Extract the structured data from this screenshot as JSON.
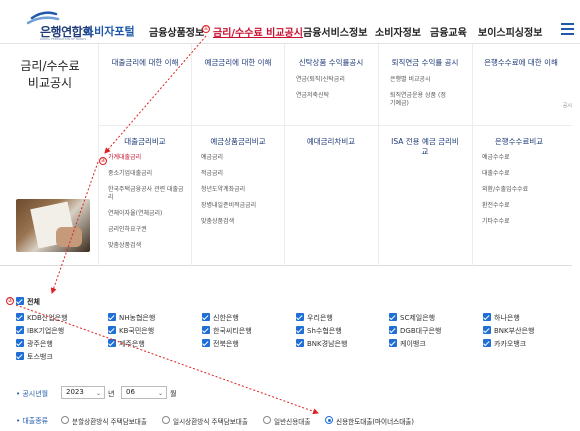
{
  "header": {
    "org_name": "은행연합회",
    "org_sub": "KOREA FEDERATION OF BANKS",
    "portal_name": "소비자포털",
    "nav": [
      "금융상품정보",
      "금리/수수료 비교공시",
      "금융서비스정보",
      "소비자정보",
      "금융교육",
      "보이스피싱정보"
    ],
    "active_nav_index": 1
  },
  "mega_menu": {
    "title": "금리/수수료 비교공시",
    "top_columns": [
      {
        "heading": "대출금리에 대한 이해",
        "items": []
      },
      {
        "heading": "예금금리에 대한 이해",
        "items": []
      },
      {
        "heading": "신탁상품 수익률공시",
        "items": [
          "연금(퇴직)신탁금리",
          "연금저축신탁"
        ]
      },
      {
        "heading": "퇴직연금 수익률 공시",
        "items": [
          "은행별 비교공시",
          "퇴직연금운용 상품 (정기예금)"
        ]
      },
      {
        "heading": "은행수수료에 대한 이해",
        "items": []
      }
    ],
    "bottom_columns": [
      {
        "heading": "대출금리비교",
        "items": [
          "가계대출금리",
          "중소기업대출금리",
          "한국주택금융공사 관련 대출금리",
          "연체이자율(연체금리)",
          "금리인하요구권",
          "맞춤상품검색"
        ]
      },
      {
        "heading": "예금상품금리비교",
        "items": [
          "예금금리",
          "적금금리",
          "청년도약계좌금리",
          "장병내일준비적금금리",
          "맞춤상품검색"
        ]
      },
      {
        "heading": "예대금리차비교",
        "items": []
      },
      {
        "heading": "ISA 전용 예금 금리비교",
        "items": []
      },
      {
        "heading": "은행수수료비교",
        "items": [
          "예금수수료",
          "대출수수료",
          "외환/수출입수수료",
          "환전수수료",
          "기타수수료"
        ]
      }
    ],
    "side_tab": "공시",
    "selected_item": "가계대출금리"
  },
  "filters": {
    "all_label": "전체",
    "banks": [
      [
        "KDB산업은행",
        "NH농협은행",
        "신한은행",
        "우리은행",
        "SC제일은행",
        "하나은행"
      ],
      [
        "IBK기업은행",
        "KB국민은행",
        "한국씨티은행",
        "Sh수협은행",
        "DGB대구은행",
        "BNK부산은행"
      ],
      [
        "광주은행",
        "제주은행",
        "전북은행",
        "BNK경남은행",
        "케이뱅크",
        "카카오뱅크"
      ],
      [
        "토스뱅크"
      ]
    ],
    "period_label": "공시년월",
    "year_value": "2023",
    "year_unit": "년",
    "month_value": "06",
    "month_unit": "월",
    "loan_type_label": "대출종류",
    "loan_types": [
      "분할상환방식 주택담보대출",
      "일시상환방식 주택담보대출",
      "일반신용대출",
      "신용한도대출(마이너스대출)"
    ],
    "loan_type_selected_index": 3
  },
  "annotations": {
    "step1": "①",
    "step2": "②",
    "step3": "③"
  },
  "colors": {
    "brand_navy": "#1f3b78",
    "brand_blue": "#1f5aa8",
    "checkbox_blue": "#1f6fd6",
    "annotation_red": "#e02020",
    "active_red": "#c8102e"
  }
}
